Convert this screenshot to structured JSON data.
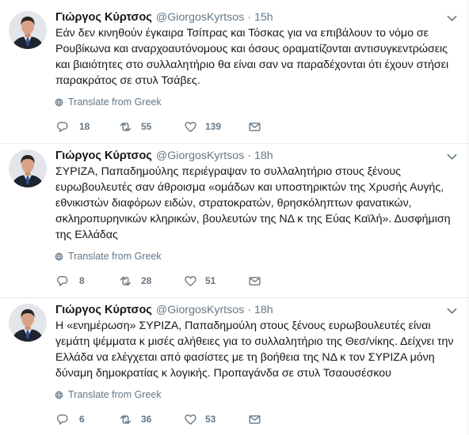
{
  "separator": "·",
  "colors": {
    "primary_text": "#14171a",
    "secondary_text": "#657786",
    "divider": "#e6ecf0",
    "background": "#ffffff"
  },
  "icons": {
    "reply": "reply-icon",
    "retweet": "retweet-icon",
    "like": "heart-icon",
    "message": "envelope-icon",
    "translate": "globe-icon",
    "menu": "chevron-down-icon"
  },
  "tweets": [
    {
      "author_name": "Γιώργος Κύρτσος",
      "handle": "@GiorgosKyrtsos",
      "time": "15h",
      "text_lines": [
        "Εάν δεν κινηθούν έγκαιρα Τσίπρας και Τόσκας για να επιβάλουν το νόμο σε",
        "Ρουβίκωνα και αναρχοαυτόνομους και όσους οραματίζονται αντισυγκεντρώσεις",
        "και βιαιότητες στο συλλαλητήριο θα είναι σαν να παραδέχονται ότι έχουν στήσει",
        "παρακράτος σε στυλ Τσάβες."
      ],
      "translate_label": "Translate from Greek",
      "reply_count": "18",
      "retweet_count": "55",
      "like_count": "139"
    },
    {
      "author_name": "Γιώργος Κύρτσος",
      "handle": "@GiorgosKyrtsos",
      "time": "18h",
      "text_lines": [
        "ΣΥΡΙΖΑ, Παπαδημούλης περιέγραψαν το συλλαλητήριο στους ξένους",
        "ευρωβουλευτές σαν άθροισμα «ομάδων και υποστηρικτών της Χρυσής Αυγής,",
        "εθνικιστών διαφόρων ειδών, στρατοκρατών, θρησκόληπτων φανατικών,",
        "σκληροπυρηνικών κληρικών, βουλευτών της ΝΔ κ της Εύας Καϊλή». Δυσφήμιση",
        "της Ελλάδας"
      ],
      "translate_label": "Translate from Greek",
      "reply_count": "8",
      "retweet_count": "28",
      "like_count": "51"
    },
    {
      "author_name": "Γιώργος Κύρτσος",
      "handle": "@GiorgosKyrtsos",
      "time": "18h",
      "text_lines": [
        "Η «ενημέρωση» ΣΥΡΙΖΑ, Παπαδημούλη στους ξένους ευρωβουλευτές είναι",
        "γεμάτη ψέμματα κ μισές αλήθειες για το συλλαλητήριο της Θεσ/νίκης. Δείχνει την",
        "Ελλάδα να ελέγχεται από φασίστες με τη βοήθεια της ΝΔ κ τον ΣΥΡΙΖΑ μόνη",
        "δύναμη δημοκρατίας κ λογικής. Προπαγάνδα σε στυλ Τσαουσέσκου"
      ],
      "translate_label": "Translate from Greek",
      "reply_count": "6",
      "retweet_count": "36",
      "like_count": "53"
    }
  ]
}
